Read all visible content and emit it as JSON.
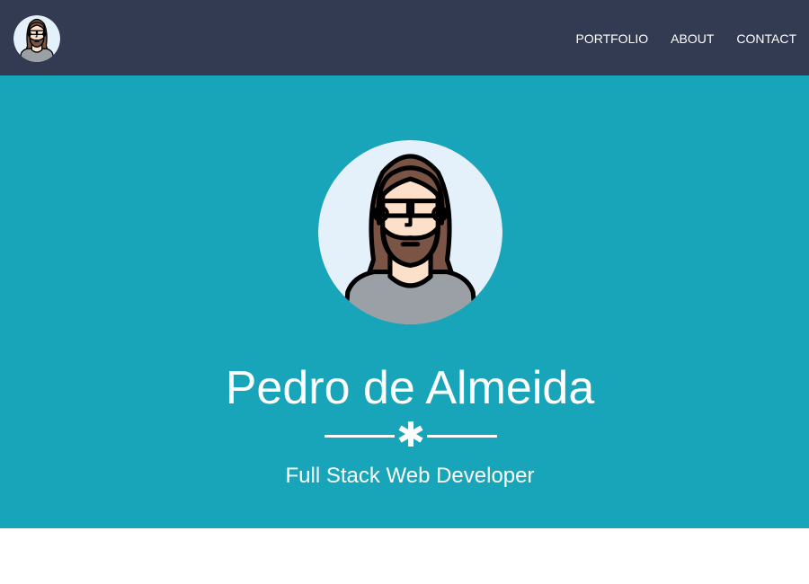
{
  "navbar": {
    "avatar_icon": "bearded-developer-avatar-icon",
    "links": [
      {
        "label": "PORTFOLIO"
      },
      {
        "label": "ABOUT"
      },
      {
        "label": "CONTACT"
      }
    ]
  },
  "hero": {
    "avatar_icon": "bearded-developer-avatar-icon",
    "name": "Pedro de Almeida",
    "divider_icon": "asterisk-star-icon",
    "divider_glyph": "✱",
    "subtitle": "Full Stack Web Developer"
  },
  "colors": {
    "navbar_bg": "#323b52",
    "hero_bg": "#18a4b9",
    "text": "#ffffff",
    "avatar_bg": "#e4f1fb",
    "hair": "#7a5545",
    "skin": "#fde0c9",
    "shirt": "#9aa0a6"
  }
}
